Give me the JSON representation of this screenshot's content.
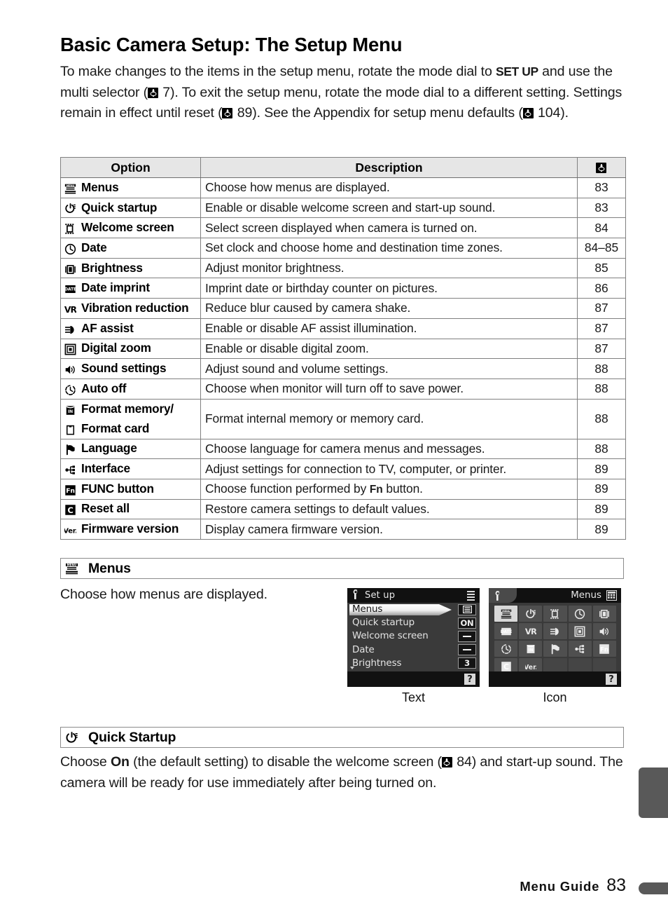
{
  "page": {
    "title": "Basic Camera Setup: The Setup Menu",
    "intro_part1": "To make changes to the items in the setup menu, rotate the mode dial to ",
    "intro_setup_bold": "SET UP",
    "intro_part2": " and use the multi selector (",
    "intro_ref1": " 7).  To exit the setup menu, rotate the mode dial to a different setting.  Settings remain in effect until reset (",
    "intro_ref2": " 89).  See the Appendix for setup menu defaults (",
    "intro_ref3": " 104)."
  },
  "table": {
    "headers": {
      "option": "Option",
      "description": "Description",
      "page": "book-icon"
    },
    "rows": [
      {
        "icon": "menu-icon",
        "option": "Menus",
        "description": "Choose how menus are displayed.",
        "page": "83",
        "thick": false
      },
      {
        "icon": "power-icon",
        "option": "Quick startup",
        "description": "Enable or disable welcome screen and start-up sound.",
        "page": "83",
        "thick": true
      },
      {
        "icon": "welcome-icon",
        "option": "Welcome screen",
        "description": "Select screen displayed when camera is turned on.",
        "page": "84",
        "thick": false
      },
      {
        "icon": "clock-icon",
        "option": "Date",
        "description": "Set clock and choose home and destination time zones.",
        "page": "84–85",
        "thick": false
      },
      {
        "icon": "brightness-icon",
        "option": "Brightness",
        "description": "Adjust monitor brightness.",
        "page": "85",
        "thick": true
      },
      {
        "icon": "date-imprint-icon",
        "option": "Date imprint",
        "description": "Imprint date or birthday counter on pictures.",
        "page": "86",
        "thick": false
      },
      {
        "icon": "vr-icon",
        "option": "Vibration reduction",
        "description": "Reduce blur caused by camera shake.",
        "page": "87",
        "thick": false
      },
      {
        "icon": "af-assist-icon",
        "option": "AF assist",
        "description": "Enable or disable AF assist illumination.",
        "page": "87",
        "thick": true
      },
      {
        "icon": "digital-zoom-icon",
        "option": "Digital zoom",
        "description": "Enable or disable digital zoom.",
        "page": "87",
        "thick": false
      },
      {
        "icon": "sound-icon",
        "option": "Sound settings",
        "description": "Adjust sound and volume settings.",
        "page": "88",
        "thick": true
      },
      {
        "icon": "auto-off-icon",
        "option": "Auto off",
        "description": "Choose when monitor will turn off to save power.",
        "page": "88",
        "thick": false
      }
    ],
    "format_row": {
      "icon_memory": "internal-memory-icon",
      "option_memory": "Format memory/",
      "icon_card": "memory-card-icon",
      "option_card": "Format card",
      "description": "Format internal memory or memory card.",
      "page": "88"
    },
    "rows2": [
      {
        "icon": "language-icon",
        "option": "Language",
        "description": "Choose language for camera menus and messages.",
        "page": "88",
        "thick": true
      },
      {
        "icon": "interface-icon",
        "option": "Interface",
        "description": "Adjust settings for connection to TV, computer, or printer.",
        "page": "89",
        "thick": false
      },
      {
        "icon": "fn-icon",
        "option": "FUNC button",
        "description_pre": "Choose function performed by ",
        "description_bold": "Fn",
        "description_post": " button.",
        "page": "89",
        "thick": true
      },
      {
        "icon": "reset-icon",
        "option": "Reset all",
        "description": "Restore camera settings to default values.",
        "page": "89",
        "thick": false
      },
      {
        "icon": "version-icon",
        "option": "Firmware version",
        "description": "Display camera firmware version.",
        "page": "89",
        "thick": false
      }
    ]
  },
  "menus_section": {
    "icon": "menu-icon",
    "title": "Menus",
    "body": "Choose how menus are displayed."
  },
  "text_screen": {
    "caption": "Text",
    "wrench_icon": "wrench-icon",
    "title": "Set up",
    "scroll_icon": "scrollbar-icon",
    "items": [
      {
        "label": "Menus",
        "value": "list-glyph",
        "selected": true
      },
      {
        "label": "Quick startup",
        "value": "ON",
        "selected": false
      },
      {
        "label": "Welcome screen",
        "value": "--",
        "selected": false
      },
      {
        "label": "Date",
        "value": "--",
        "selected": false
      },
      {
        "label": "Brightness",
        "value": "3",
        "selected": false
      }
    ],
    "help_badge": "?"
  },
  "icon_screen": {
    "caption": "Icon",
    "wrench_icon": "wrench-icon",
    "title": "Menus",
    "grid_badge_icon": "grid-icon",
    "cells": [
      {
        "icon": "menu-icon",
        "selected": true
      },
      {
        "icon": "power-icon",
        "selected": false
      },
      {
        "icon": "welcome-icon",
        "selected": false
      },
      {
        "icon": "clock-icon",
        "selected": false
      },
      {
        "icon": "brightness-icon",
        "selected": false
      },
      {
        "icon": "date-imprint-icon",
        "selected": false
      },
      {
        "icon": "vr-icon",
        "selected": false
      },
      {
        "icon": "af-assist-icon",
        "selected": false
      },
      {
        "icon": "digital-zoom-icon",
        "selected": false
      },
      {
        "icon": "sound-icon",
        "selected": false
      },
      {
        "icon": "auto-off-icon",
        "selected": false
      },
      {
        "icon": "internal-memory-icon",
        "selected": false
      },
      {
        "icon": "language-icon",
        "selected": false
      },
      {
        "icon": "interface-icon",
        "selected": false
      },
      {
        "icon": "fn-icon",
        "selected": false
      },
      {
        "icon": "reset-icon",
        "selected": false
      },
      {
        "icon": "version-icon",
        "selected": false
      },
      {
        "icon": "empty",
        "selected": false
      },
      {
        "icon": "empty",
        "selected": false
      },
      {
        "icon": "empty",
        "selected": false
      }
    ],
    "help_badge": "?"
  },
  "quick_section": {
    "icon": "power-icon",
    "title": "Quick Startup",
    "body_pre": "Choose ",
    "body_bold": "On",
    "body_mid": " (the default setting) to disable the welcome screen (",
    "body_post": " 84) and start-up sound.  The camera will be ready for use immediately after being turned on."
  },
  "footer": {
    "label": "Menu Guide",
    "page_number": "83"
  },
  "colors": {
    "header_bg": "#e6e6e6",
    "rule": "#808080",
    "screen_bg": "#3a3a3a",
    "screen_bar": "#111111",
    "tab_marker": "#595959"
  }
}
